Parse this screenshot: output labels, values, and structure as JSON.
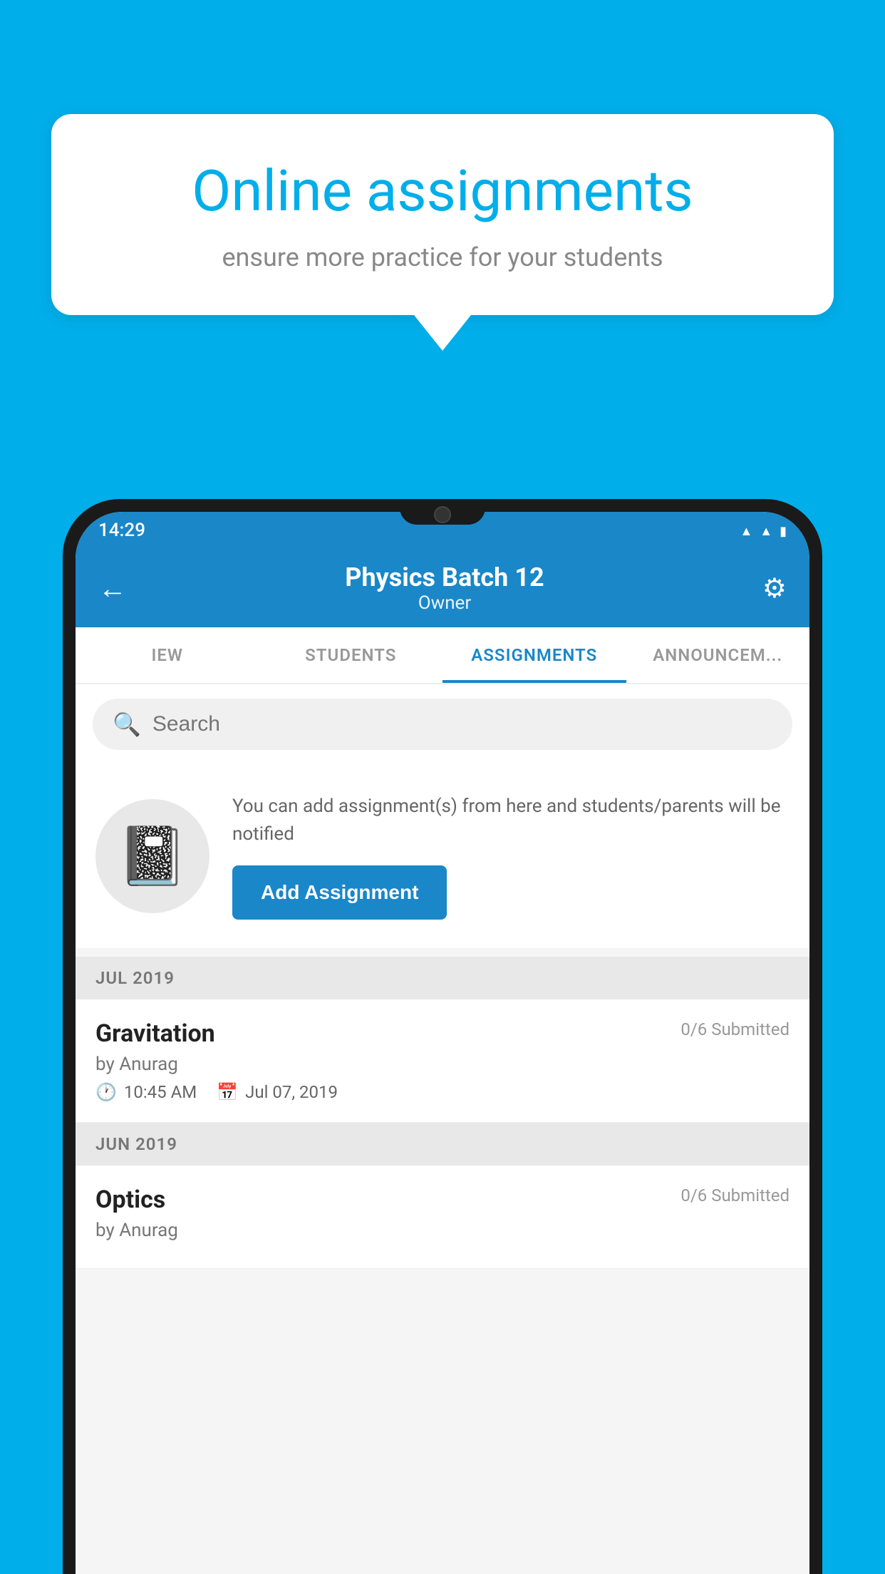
{
  "background_color": "#00AEEA",
  "speech_bubble": {
    "title": "Online assignments",
    "subtitle": "ensure more practice for your students"
  },
  "status_bar": {
    "time": "14:29",
    "icons": [
      "wifi",
      "signal",
      "battery"
    ]
  },
  "header": {
    "title": "Physics Batch 12",
    "subtitle": "Owner",
    "back_label": "←",
    "settings_label": "⚙"
  },
  "tabs": [
    {
      "label": "IEW",
      "active": false
    },
    {
      "label": "STUDENTS",
      "active": false
    },
    {
      "label": "ASSIGNMENTS",
      "active": true
    },
    {
      "label": "ANNOUNCEM...",
      "active": false
    }
  ],
  "search": {
    "placeholder": "Search"
  },
  "add_assignment_section": {
    "description": "You can add assignment(s) from here and students/parents will be notified",
    "button_label": "Add Assignment"
  },
  "sections": [
    {
      "month_label": "JUL 2019",
      "assignments": [
        {
          "name": "Gravitation",
          "submitted": "0/6 Submitted",
          "by": "by Anurag",
          "time": "10:45 AM",
          "date": "Jul 07, 2019"
        }
      ]
    },
    {
      "month_label": "JUN 2019",
      "assignments": [
        {
          "name": "Optics",
          "submitted": "0/6 Submitted",
          "by": "by Anurag",
          "time": "",
          "date": ""
        }
      ]
    }
  ]
}
